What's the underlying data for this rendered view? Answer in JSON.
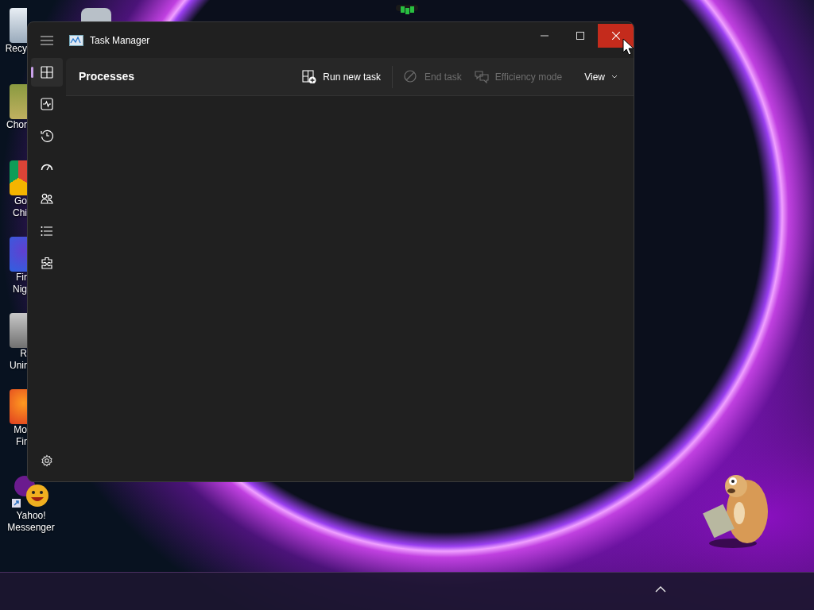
{
  "desktop": {
    "icons": [
      {
        "kind": "recycle",
        "label_lines": [
          "Recy"
        ]
      },
      {
        "kind": "photo",
        "label_lines": [
          "Chor"
        ]
      },
      {
        "kind": "chrome",
        "label_lines": [
          "Go",
          "Chi"
        ]
      },
      {
        "kind": "firefox-nightly",
        "label_lines": [
          "Fir",
          "Nig"
        ]
      },
      {
        "kind": "uninstaller",
        "label_lines": [
          "R",
          "Unir"
        ]
      },
      {
        "kind": "firefox",
        "label_lines": [
          "Mo",
          "Fir"
        ]
      },
      {
        "kind": "yahoo",
        "label_lines": [
          "Yahoo!",
          "Messenger"
        ]
      }
    ]
  },
  "window": {
    "title": "Task Manager",
    "controls": [
      {
        "kind": "minimize",
        "hovered": false
      },
      {
        "kind": "maximize",
        "hovered": false
      },
      {
        "kind": "close",
        "hovered": true
      }
    ],
    "sidebar": {
      "items": [
        {
          "kind": "processes",
          "selected": true
        },
        {
          "kind": "performance",
          "selected": false
        },
        {
          "kind": "app-history",
          "selected": false
        },
        {
          "kind": "startup",
          "selected": false
        },
        {
          "kind": "users",
          "selected": false
        },
        {
          "kind": "details",
          "selected": false
        },
        {
          "kind": "services",
          "selected": false
        }
      ],
      "settings": {
        "kind": "settings"
      }
    },
    "page_title": "Processes",
    "toolbar": [
      {
        "kind": "run",
        "label": "Run new task",
        "disabled": false
      },
      {
        "kind": "end",
        "label": "End task",
        "disabled": true
      },
      {
        "kind": "efficiency",
        "label": "Efficiency mode",
        "disabled": true
      },
      {
        "kind": "view",
        "label": "View",
        "disabled": false
      }
    ]
  }
}
